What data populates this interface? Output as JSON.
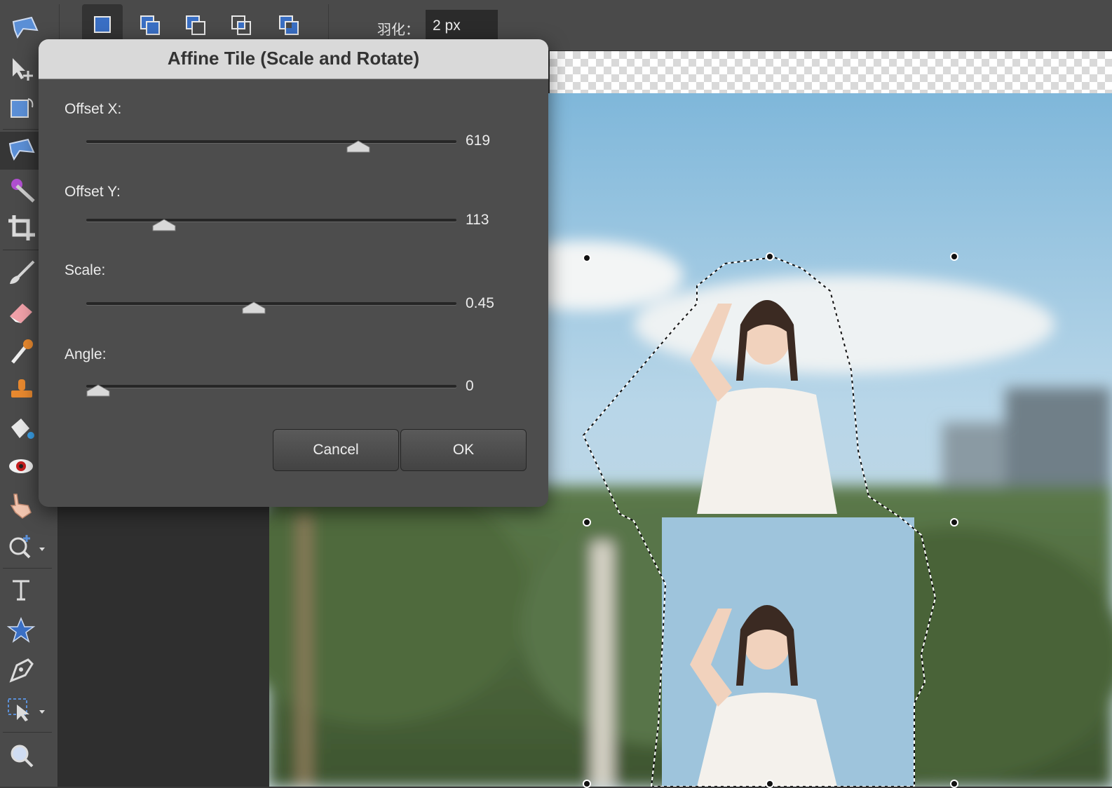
{
  "toolbar_options": {
    "selection_modes": [
      {
        "name": "new-selection",
        "active": true
      },
      {
        "name": "add-to-selection",
        "active": false
      },
      {
        "name": "subtract-from-selection",
        "active": false
      },
      {
        "name": "intersect-selection",
        "active": false
      },
      {
        "name": "exclude-overlap",
        "active": false
      }
    ],
    "feather_label": "羽化：",
    "feather_value": "2 px"
  },
  "tools": [
    "lasso-tool-icon",
    "move-tool-icon",
    "transform-tool-icon",
    "lasso-tool-icon",
    "magic-wand-icon",
    "crop-icon",
    "brush-icon",
    "eraser-icon",
    "eyedropper-icon",
    "clone-stamp-icon",
    "paint-bucket-icon",
    "red-eye-icon",
    "hand-icon",
    "zoom-icon",
    "text-tool-icon",
    "star-shape-icon",
    "pen-icon",
    "selection-arrow-icon",
    "zoom-icon"
  ],
  "dialog": {
    "title": "Affine Tile (Scale and Rotate)",
    "fields": [
      {
        "label": "Offset X:",
        "value": "619",
        "position": 0.75
      },
      {
        "label": "Offset Y:",
        "value": "113",
        "position": 0.19
      },
      {
        "label": "Scale:",
        "value": "0.45",
        "position": 0.45
      },
      {
        "label": "Angle:",
        "value": "0",
        "position": 0.0
      }
    ],
    "cancel_label": "Cancel",
    "ok_label": "OK"
  },
  "colors": {
    "accent_blue": "#3a6fc4",
    "panel": "#4a4a4a",
    "dialog_bg": "#4d4d4d"
  }
}
